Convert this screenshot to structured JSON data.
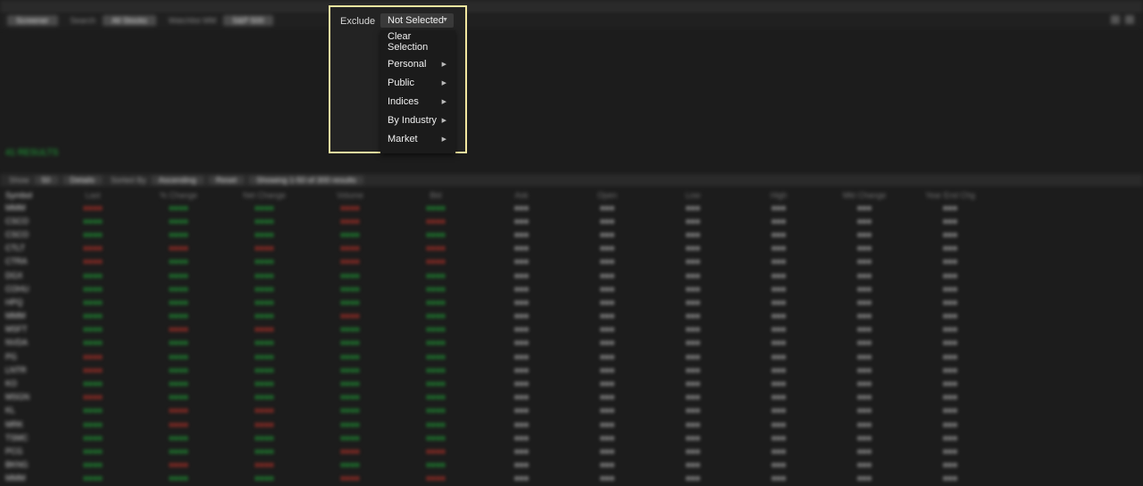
{
  "toolbar": {
    "screener_label": "Screener",
    "search_label": "Search",
    "universe_value": "All Stocks",
    "watch_label": "Watchlist MM",
    "list_value": "S&P 500"
  },
  "popup": {
    "exclude_label": "Exclude",
    "selected_value": "Not Selected",
    "menu": {
      "clear_label": "Clear Selection",
      "items": [
        "Personal",
        "Public",
        "Indices",
        "By Industry",
        "Market"
      ]
    }
  },
  "results_text": "41 RESULTS",
  "filterbar": {
    "show_label": "Show",
    "show_value": "50",
    "details_value": "Details",
    "sort_label": "Sorted By",
    "order_value": "Ascending",
    "reset_label": "Reset",
    "showing_text": "Showing 1-50 of 300 results"
  },
  "grid": {
    "headers": [
      "Symbol",
      "Last",
      "% Change",
      "Net Change",
      "Volume",
      "Bid",
      "Ask",
      "Open",
      "Low",
      "High",
      "Mkt Change",
      "Year End Chg"
    ],
    "rows": [
      [
        "MMM",
        "neg",
        "pos",
        "pos",
        "neg",
        "pos"
      ],
      [
        "CSCO",
        "pos",
        "pos",
        "pos",
        "neg",
        "neg"
      ],
      [
        "CSCO",
        "pos",
        "pos",
        "pos",
        "pos",
        "pos"
      ],
      [
        "CTLT",
        "neg",
        "neg",
        "neg",
        "neg",
        "neg"
      ],
      [
        "CTRA",
        "neg",
        "pos",
        "pos",
        "neg",
        "neg"
      ],
      [
        "DGX",
        "pos",
        "pos",
        "pos",
        "pos",
        "pos"
      ],
      [
        "COHU",
        "pos",
        "pos",
        "pos",
        "pos",
        "pos"
      ],
      [
        "HPQ",
        "pos",
        "pos",
        "pos",
        "pos",
        "pos"
      ],
      [
        "MMM",
        "pos",
        "pos",
        "pos",
        "neg",
        "pos"
      ],
      [
        "MSFT",
        "pos",
        "neg",
        "neg",
        "pos",
        "pos"
      ],
      [
        "NVDA",
        "pos",
        "pos",
        "pos",
        "pos",
        "pos"
      ],
      [
        "PG",
        "neg",
        "pos",
        "pos",
        "pos",
        "pos"
      ],
      [
        "LNTR",
        "neg",
        "pos",
        "pos",
        "pos",
        "pos"
      ],
      [
        "KO",
        "pos",
        "pos",
        "pos",
        "pos",
        "pos"
      ],
      [
        "MSGN",
        "neg",
        "pos",
        "pos",
        "pos",
        "pos"
      ],
      [
        "KL",
        "pos",
        "neg",
        "neg",
        "pos",
        "pos"
      ],
      [
        "MRK",
        "pos",
        "neg",
        "neg",
        "pos",
        "pos"
      ],
      [
        "TSMC",
        "pos",
        "pos",
        "pos",
        "pos",
        "pos"
      ],
      [
        "PCG",
        "pos",
        "pos",
        "pos",
        "neg",
        "neg"
      ],
      [
        "BKNG",
        "pos",
        "neg",
        "neg",
        "pos",
        "pos"
      ],
      [
        "MMM",
        "pos",
        "pos",
        "pos",
        "neg",
        "neg"
      ]
    ]
  }
}
